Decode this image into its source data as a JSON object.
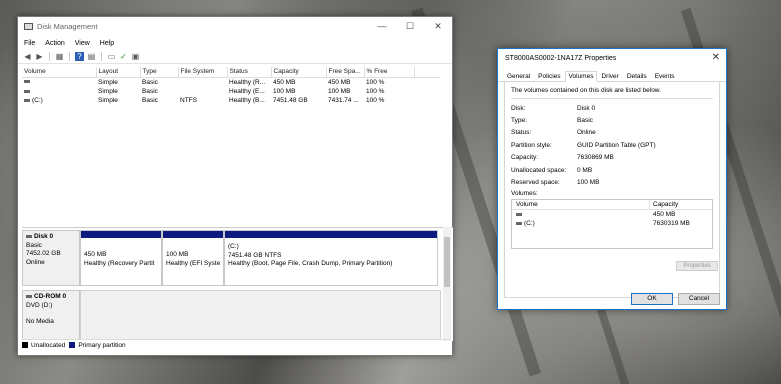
{
  "disk_management": {
    "title": "Disk Management",
    "menu": [
      "File",
      "Action",
      "View",
      "Help"
    ],
    "window_buttons": [
      "—",
      "☐",
      "✕"
    ],
    "columns": [
      "Volume",
      "Layout",
      "Type",
      "File System",
      "Status",
      "Capacity",
      "Free Spa...",
      "% Free"
    ],
    "rows": [
      [
        "",
        "Simple",
        "Basic",
        "",
        "Healthy (R...",
        "450 MB",
        "450 MB",
        "100 %"
      ],
      [
        "",
        "Simple",
        "Basic",
        "",
        "Healthy (E...",
        "100 MB",
        "100 MB",
        "100 %"
      ],
      [
        "(C:)",
        "Simple",
        "Basic",
        "NTFS",
        "Healthy (B...",
        "7451.48 GB",
        "7431.74 ...",
        "100 %"
      ]
    ],
    "disk0": {
      "name": "Disk 0",
      "type": "Basic",
      "size": "7452.02 GB",
      "status": "Online",
      "partitions": [
        {
          "line1": "450 MB",
          "line2": "Healthy (Recovery Partit"
        },
        {
          "line1": "100 MB",
          "line2": "Healthy (EFI Syste"
        },
        {
          "line0": "(C:)",
          "line1": "7451.48 GB NTFS",
          "line2": "Healthy (Boot, Page File, Crash Dump, Primary Partition)"
        }
      ]
    },
    "cdrom0": {
      "name": "CD-ROM 0",
      "type": "DVD (D:)",
      "media": "No Media"
    },
    "legend": {
      "unallocated": "Unallocated",
      "primary": "Primary partition",
      "unallocated_color": "#000000",
      "primary_color": "#0d1b80"
    }
  },
  "properties": {
    "title": "ST8000AS0002-1NA17Z Properties",
    "close": "✕",
    "tabs": [
      "General",
      "Policies",
      "Volumes",
      "Driver",
      "Details",
      "Events"
    ],
    "active_tab": "Volumes",
    "intro": "The volumes contained on this disk are listed below.",
    "fields": [
      {
        "label": "Disk:",
        "value": "Disk 0"
      },
      {
        "label": "Type:",
        "value": "Basic"
      },
      {
        "label": "Status:",
        "value": "Online"
      },
      {
        "label": "Partition style:",
        "value": "GUID Partition Table (GPT)"
      },
      {
        "label": "Capacity:",
        "value": "7630869 MB"
      },
      {
        "label": "Unallocated space:",
        "value": "0 MB"
      },
      {
        "label": "Reserved space:",
        "value": "100 MB"
      }
    ],
    "volumes_caption": "Volumes:",
    "volumes_columns": [
      "Volume",
      "Capacity"
    ],
    "volumes_rows": [
      {
        "volume": "",
        "capacity": "450 MB"
      },
      {
        "volume": "(C:)",
        "capacity": "7630319 MB"
      }
    ],
    "properties_button": "Properties",
    "ok_button": "OK",
    "cancel_button": "Cancel"
  }
}
